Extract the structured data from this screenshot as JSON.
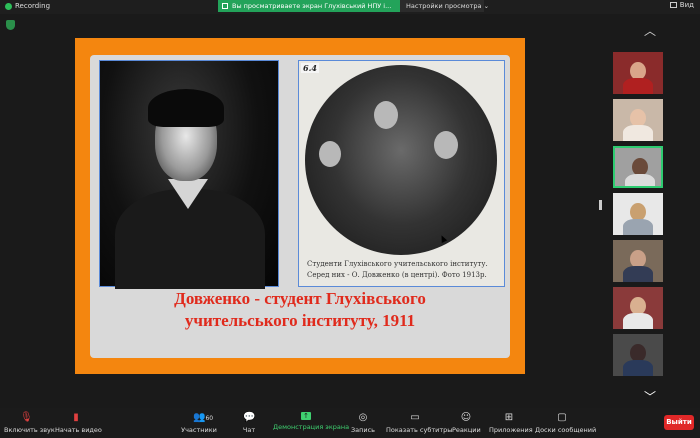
{
  "topbar": {
    "recording_label": "Recording",
    "share_banner": "Вы просматриваете экран Глухівський НПУ і...",
    "view_options": "Настройки просмотра",
    "view_label": "Вид"
  },
  "slide": {
    "photo_tag": "6.4",
    "caption_line1": "Студенти Глухівського учительського інституту.",
    "caption_line2": "Серед них - О. Довженко (в центрі). Фото 1913р.",
    "title_line1": "Довженко - студент Глухівського",
    "title_line2": "учительського інституту, 1911"
  },
  "toolbar": {
    "audio_label": "Включить звук",
    "video_label": "Начать видео",
    "participants_label": "Участники",
    "participants_count": "60",
    "chat_label": "Чат",
    "share_label": "Демонстрация экрана",
    "record_label": "Запись",
    "subtitles_label": "Показать субтитры",
    "reactions_label": "Реакции",
    "apps_label": "Приложения",
    "whiteboard_label": "Доски сообщений",
    "leave_label": "Выйти"
  },
  "colors": {
    "slide_background": "#f4860f",
    "title_red": "#e02a1c",
    "active_green": "#2ecc71",
    "leave_red": "#e02828"
  }
}
